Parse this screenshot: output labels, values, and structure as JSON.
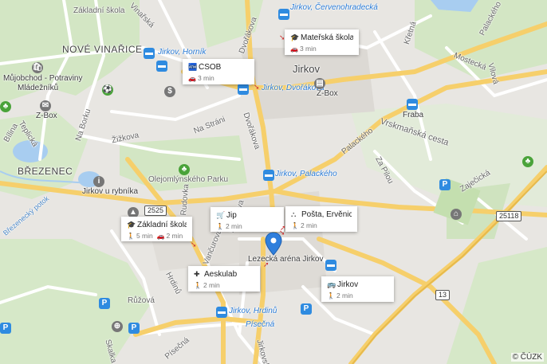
{
  "map": {
    "places": {
      "jirkov": "Jirkov",
      "nove_vinarice": "NOVÉ VINAŘICE",
      "brezenec": "BŘEZENEC",
      "bilina": "Bílina"
    },
    "streets": {
      "zakladni_skola": "Základní škola",
      "na_borku": "Na Borku",
      "zizkova": "Žižkova",
      "na_strani": "Na Stráni",
      "dvorakova": "Dvořákova",
      "dvorakova2": "Dvořákova",
      "olejomlynskeho_park": "Olejomlýnského Parku",
      "teplicka": "Teplická",
      "palackeho": "Palackého",
      "vrskmanska": "Vrskmaňská cesta",
      "za_pilou": "Za Pilou",
      "mostecka": "Mostecká",
      "vilova": "Vilová",
      "zajecicka": "Zaječická",
      "palackeho2": "Palackého",
      "krestna": "Křetná",
      "rudovka": "Rudovka",
      "nemcova": "Němcova",
      "vancurova": "Vančurova",
      "hrdinu": "Hrdinů",
      "ruzova": "Růžová",
      "pisecna": "Písečná",
      "skalka": "Skalka",
      "brezenecky_potok": "Březenecký potok",
      "bezrucova": "Bezručova",
      "jirkovska": "Jirkovská",
      "vinarska": "Vinařská"
    },
    "pois": {
      "mujobchod": "Můjobchod - Potraviny",
      "mladezniku": "Mládežníků",
      "zbox1": "Z-Box",
      "zbox2": "Z-Box",
      "fraba": "Fraba",
      "jirkov_u_rybnika": "Jirkov u rybníka",
      "lezecka_arena": "Lezecká aréna Jirkov"
    },
    "stops": {
      "jirkov_hornik": "Jirkov, Horník",
      "jirkov_cervenohradecka": "Jirkov, Červenohradecká",
      "jirkov_dvorakova": "Jirkov, Dvořákova",
      "jirkov_palackeho": "Jirkov, Palackého",
      "jirkov_hrdinu": "Jirkov, Hrdinů",
      "pisecna_stop": "Písečná"
    },
    "road_numbers": {
      "r2525": "2525",
      "r25118": "25118",
      "r13": "13"
    },
    "cards": [
      {
        "id": "materska",
        "icon": "school-icon",
        "glyph": "🎓",
        "title": "Mateřská škola Ji...",
        "sub_icon": "car-icon",
        "sub_glyph": "🚗",
        "sub": "3 min"
      },
      {
        "id": "csob",
        "icon": "atm-icon",
        "glyph": "🏧",
        "title": "ČSOB",
        "sub_icon": "car-icon",
        "sub_glyph": "🚗",
        "sub": "3 min"
      },
      {
        "id": "jip",
        "icon": "cart-icon",
        "glyph": "🛒",
        "title": "Jip",
        "sub_icon": "walk-icon",
        "sub_glyph": "🚶",
        "sub": "2 min"
      },
      {
        "id": "posta",
        "icon": "post-icon",
        "glyph": "⛬",
        "title": "Pošta, Ervěnická",
        "sub_icon": "walk-icon",
        "sub_glyph": "🚶",
        "sub": "2 min"
      },
      {
        "id": "zakladni",
        "icon": "school-icon",
        "glyph": "🎓",
        "title": "Základní škola Jir...",
        "sub_icon": "walk-icon",
        "sub_glyph": "🚶",
        "sub": "5 min",
        "sub2_glyph": "🚗",
        "sub2": "2 min"
      },
      {
        "id": "aeskulab",
        "icon": "medical-icon",
        "glyph": "✚",
        "title": "Aeskulab",
        "sub_icon": "walk-icon",
        "sub_glyph": "🚶",
        "sub": "2 min"
      },
      {
        "id": "jirkov_stop",
        "icon": "bus-icon",
        "glyph": "🚌",
        "title": "Jirkov",
        "sub_icon": "walk-icon",
        "sub_glyph": "🚶",
        "sub": "2 min"
      }
    ],
    "copyright": "© ČÚZK",
    "colors": {
      "land": "#e8e6e2",
      "green": "#cfe3bf",
      "water": "#a8cdf0",
      "road_major": "#f6cf6b",
      "road_minor": "#ffffff",
      "pin": "#2f7fdc",
      "bus": "#2f8be0"
    }
  }
}
